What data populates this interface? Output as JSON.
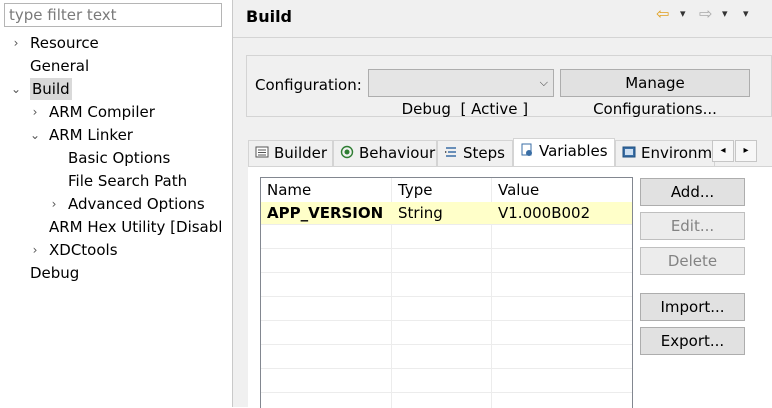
{
  "filter": {
    "placeholder": "type filter text"
  },
  "tree": {
    "items": [
      {
        "label": "Resource",
        "twisty": "›"
      },
      {
        "label": "General",
        "twisty": ""
      },
      {
        "label": "Build",
        "twisty": "⌄"
      },
      {
        "label": "ARM Compiler",
        "twisty": "›"
      },
      {
        "label": "ARM Linker",
        "twisty": "⌄"
      },
      {
        "label": "Basic Options",
        "twisty": ""
      },
      {
        "label": "File Search Path",
        "twisty": ""
      },
      {
        "label": "Advanced Options",
        "twisty": "›"
      },
      {
        "label": "ARM Hex Utility  [Disabl",
        "twisty": ""
      },
      {
        "label": "XDCtools",
        "twisty": "›"
      },
      {
        "label": "Debug",
        "twisty": ""
      }
    ]
  },
  "header": {
    "title": "Build",
    "nav": {
      "back_icon": "⇦",
      "forward_icon": "⇨",
      "dropdown_icon": "▾"
    }
  },
  "config": {
    "label": "Configuration:",
    "selected": "Debug  [ Active ]",
    "manage_label": "Manage Configurations..."
  },
  "tabs": [
    {
      "label": "Builder",
      "icon": "builder-icon"
    },
    {
      "label": "Behaviour",
      "icon": "behaviour-icon"
    },
    {
      "label": "Steps",
      "icon": "steps-icon"
    },
    {
      "label": "Variables",
      "icon": "variables-icon",
      "active": true
    },
    {
      "label": "Environme",
      "icon": "environment-icon"
    }
  ],
  "tab_scroll": {
    "left": "◂",
    "right": "▸"
  },
  "variables": {
    "columns": [
      "Name",
      "Type",
      "Value"
    ],
    "rows": [
      {
        "name": "APP_VERSION",
        "type": "String",
        "value": "V1.000B002"
      }
    ]
  },
  "buttons": {
    "add": "Add...",
    "edit": "Edit...",
    "delete": "Delete",
    "import": "Import...",
    "export": "Export..."
  },
  "colors": {
    "selected_row": "#ffffc9",
    "panel_bg": "#f0f0f0",
    "nav_back": "#e0a020"
  }
}
